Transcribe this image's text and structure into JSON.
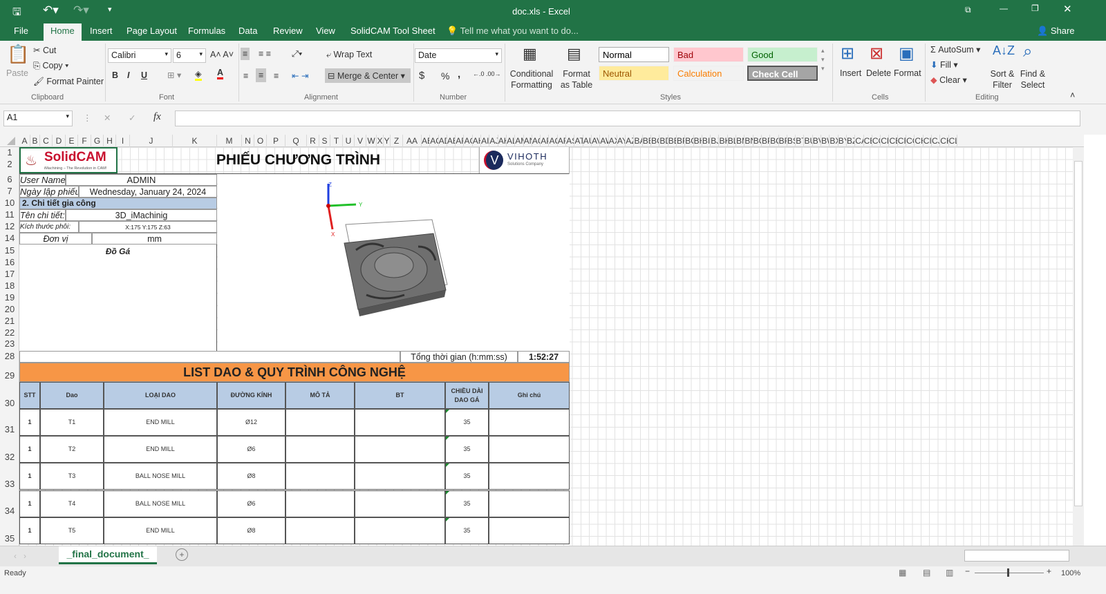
{
  "window": {
    "title": "doc.xls - Excel",
    "share": "Share",
    "tell_me": "Tell me what you want to do..."
  },
  "menu": {
    "file": "File",
    "tabs": [
      "Home",
      "Insert",
      "Page Layout",
      "Formulas",
      "Data",
      "Review",
      "View",
      "SolidCAM Tool Sheet"
    ]
  },
  "ribbon": {
    "clipboard": {
      "paste": "Paste",
      "cut": "Cut",
      "copy": "Copy",
      "format_painter": "Format Painter",
      "label": "Clipboard"
    },
    "font": {
      "name": "Calibri",
      "size": "6",
      "bold": "B",
      "italic": "I",
      "underline": "U",
      "label": "Font"
    },
    "alignment": {
      "wrap_text": "Wrap Text",
      "merge_center": "Merge & Center",
      "label": "Alignment"
    },
    "number": {
      "format": "Date",
      "currency": "$",
      "percent": "%",
      "comma": ",",
      "label": "Number"
    },
    "styles": {
      "conditional": "Conditional Formatting",
      "format_as_table": "Format as Table",
      "cells": [
        {
          "name": "Normal",
          "bg": "#ffffff",
          "fg": "#000000"
        },
        {
          "name": "Bad",
          "bg": "#ffc7ce",
          "fg": "#9c0006"
        },
        {
          "name": "Good",
          "bg": "#c6efce",
          "fg": "#006100"
        },
        {
          "name": "Neutral",
          "bg": "#ffeb9c",
          "fg": "#9c5700"
        },
        {
          "name": "Calculation",
          "bg": "#f2f2f2",
          "fg": "#fa7d00"
        },
        {
          "name": "Check Cell",
          "bg": "#a5a5a5",
          "fg": "#ffffff"
        }
      ],
      "label": "Styles"
    },
    "cells": {
      "insert": "Insert",
      "delete": "Delete",
      "format": "Format",
      "label": "Cells"
    },
    "editing": {
      "autosum": "AutoSum",
      "fill": "Fill",
      "clear": "Clear",
      "sort_filter": "Sort & Filter",
      "find_select": "Find & Select",
      "label": "Editing"
    }
  },
  "formula_bar": {
    "name_box": "A1",
    "fx": "fx",
    "value": ""
  },
  "columns": [
    "A",
    "B",
    "C",
    "D",
    "E",
    "F",
    "G",
    "H",
    "I",
    "J",
    "K",
    "M",
    "N",
    "O",
    "P",
    "Q",
    "R",
    "S",
    "T",
    "U",
    "V",
    "W",
    "X",
    "Y",
    "Z",
    "AA",
    "AB",
    "AC",
    "AD",
    "AE",
    "AF",
    "AG",
    "AH",
    "AI",
    "AJ",
    "AK",
    "AL",
    "AM",
    "AN",
    "AO",
    "AP",
    "AQ",
    "AR",
    "AS",
    "AT",
    "AU",
    "AV",
    "AW",
    "AX",
    "AY",
    "AZ",
    "BA",
    "BB",
    "BC",
    "BD",
    "BE",
    "BF",
    "BG",
    "BH",
    "BI",
    "BJ",
    "BK",
    "BL",
    "BM",
    "BN",
    "BO",
    "BP",
    "BQ",
    "BR",
    "BS",
    "BT",
    "BU",
    "BV",
    "BW",
    "BX",
    "BY",
    "BZ",
    "CA",
    "CB",
    "CC",
    "CD",
    "CE",
    "CF",
    "CG",
    "CH",
    "CI",
    "CJ",
    "CK",
    "CL"
  ],
  "rows": [
    "1",
    "2",
    "6",
    "7",
    "10",
    "11",
    "12",
    "14",
    "15",
    "16",
    "17",
    "18",
    "19",
    "20",
    "21",
    "22",
    "23",
    "28",
    "29",
    "30",
    "31",
    "32",
    "33",
    "34",
    "35"
  ],
  "sheet": {
    "logo_left": "SolidCAM",
    "logo_left_tag": "iMachining – The Revolution in CAM!",
    "title": "PHIẾU CHƯƠNG TRÌNH",
    "logo_right": "VIHOTH",
    "logo_right_tag": "Solutions Company",
    "user_label": "User Name:",
    "user": "ADMIN",
    "date_label": "Ngày lập phiếu:",
    "date": "Wednesday, January 24, 2024",
    "section": "2. Chi tiết gia công",
    "part_label": "Tên chi tiết:",
    "part": "3D_iMachinig",
    "stock_label": "Kích thước phôi:",
    "stock": "X:175 Y:175 Z:63",
    "unit_label": "Đơn vị",
    "unit": "mm",
    "fixture": "Đồ Gá",
    "axis": {
      "x": "X",
      "y": "Y",
      "z": "Z"
    },
    "total_label": "Tổng thời gian (h:mm:ss)",
    "total": "1:52:27",
    "list_title": "LIST DAO & QUY TRÌNH CÔNG NGHỆ",
    "headers": [
      "STT",
      "Dao",
      "LOẠI DAO",
      "ĐƯỜNG KÍNH",
      "MÔ TẢ",
      "BT",
      "CHIỀU DÀI DAO GÁ",
      "Ghi chú"
    ],
    "tools": [
      [
        "1",
        "T1",
        "END MILL",
        "Ø12",
        "",
        "",
        "35",
        ""
      ],
      [
        "1",
        "T2",
        "END MILL",
        "Ø6",
        "",
        "",
        "35",
        ""
      ],
      [
        "1",
        "T3",
        "BALL NOSE MILL",
        "Ø8",
        "",
        "",
        "35",
        ""
      ],
      [
        "1",
        "T4",
        "BALL NOSE MILL",
        "Ø6",
        "",
        "",
        "35",
        ""
      ],
      [
        "1",
        "T5",
        "END MILL",
        "Ø8",
        "",
        "",
        "35",
        ""
      ]
    ]
  },
  "sheet_tab": "_final_document_",
  "status": {
    "ready": "Ready",
    "zoom": "100%"
  },
  "colors": {
    "excel_green": "#217346",
    "orange": "#f79646",
    "header_blue": "#b8cce4"
  }
}
